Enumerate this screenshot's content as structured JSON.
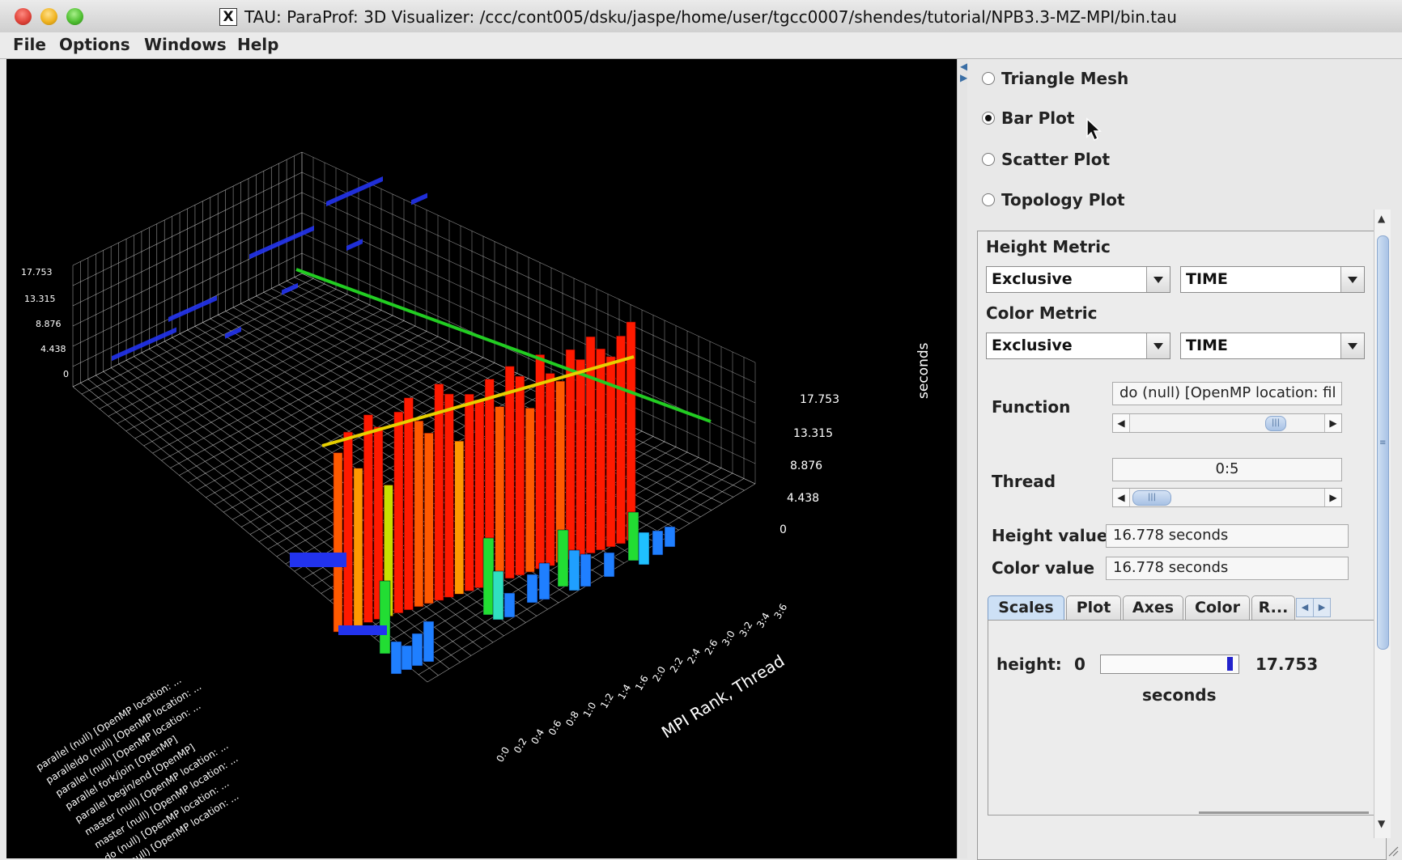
{
  "window": {
    "title": "TAU: ParaProf: 3D Visualizer: /ccc/cont005/dsku/jaspe/home/user/tgcc0007/shendes/tutorial/NPB3.3-MZ-MPI/bin.tau",
    "x_icon": "X"
  },
  "menu": [
    "File",
    "Options",
    "Windows",
    "Help"
  ],
  "plot": {
    "z_ticks": [
      "17.753",
      "13.315",
      "8.876",
      "4.438",
      "0"
    ],
    "z_ticks_left": [
      "17.753",
      "13.315",
      "8.876",
      "4.438",
      "0"
    ],
    "z_unit": "seconds",
    "thread_axis_label": "MPI Rank, Thread",
    "thread_ticks": [
      "0:0",
      "0:2",
      "0:4",
      "0:6",
      "0:8",
      "1:0",
      "1:2",
      "1:4",
      "1:6",
      "2:0",
      "2:2",
      "2:4",
      "2:6",
      "3:0",
      "3:2",
      "3:4",
      "3:6"
    ],
    "function_labels": [
      "parallel (null) [OpenMP location: ...",
      "paralleldo (null) [OpenMP location: ...",
      "parallel (null) [OpenMP location: ...",
      "parallel fork/join [OpenMP]",
      "parallel begin/end [OpenMP]",
      "master (null) [OpenMP location: ...",
      "master (null) [OpenMP location: ...",
      "do (null) [OpenMP location: ...",
      "do (null) [OpenMP location: ..."
    ]
  },
  "panel": {
    "plot_types": [
      {
        "label": "Triangle Mesh",
        "selected": false
      },
      {
        "label": "Bar Plot",
        "selected": true
      },
      {
        "label": "Scatter Plot",
        "selected": false
      },
      {
        "label": "Topology Plot",
        "selected": false
      }
    ],
    "height_metric": {
      "label": "Height Metric",
      "type": "Exclusive",
      "metric": "TIME"
    },
    "color_metric": {
      "label": "Color Metric",
      "type": "Exclusive",
      "metric": "TIME"
    },
    "function": {
      "label": "Function",
      "value": "do (null) [OpenMP location: fil"
    },
    "thread": {
      "label": "Thread",
      "value": "0:5"
    },
    "height_value": {
      "label": "Height value",
      "value": "16.778 seconds"
    },
    "color_value": {
      "label": "Color value",
      "value": "16.778 seconds"
    },
    "tabs": [
      "Scales",
      "Plot",
      "Axes",
      "Color",
      "R..."
    ],
    "active_tab": "Scales",
    "scales": {
      "label": "height:",
      "min": "0",
      "max": "17.753",
      "unit": "seconds",
      "level": 0.95
    }
  },
  "colors": {
    "background": "#000000",
    "grid": "#d8d8d8",
    "axis_line": "#22bb22",
    "high": "#ff1a00",
    "low": "#2050ff"
  }
}
